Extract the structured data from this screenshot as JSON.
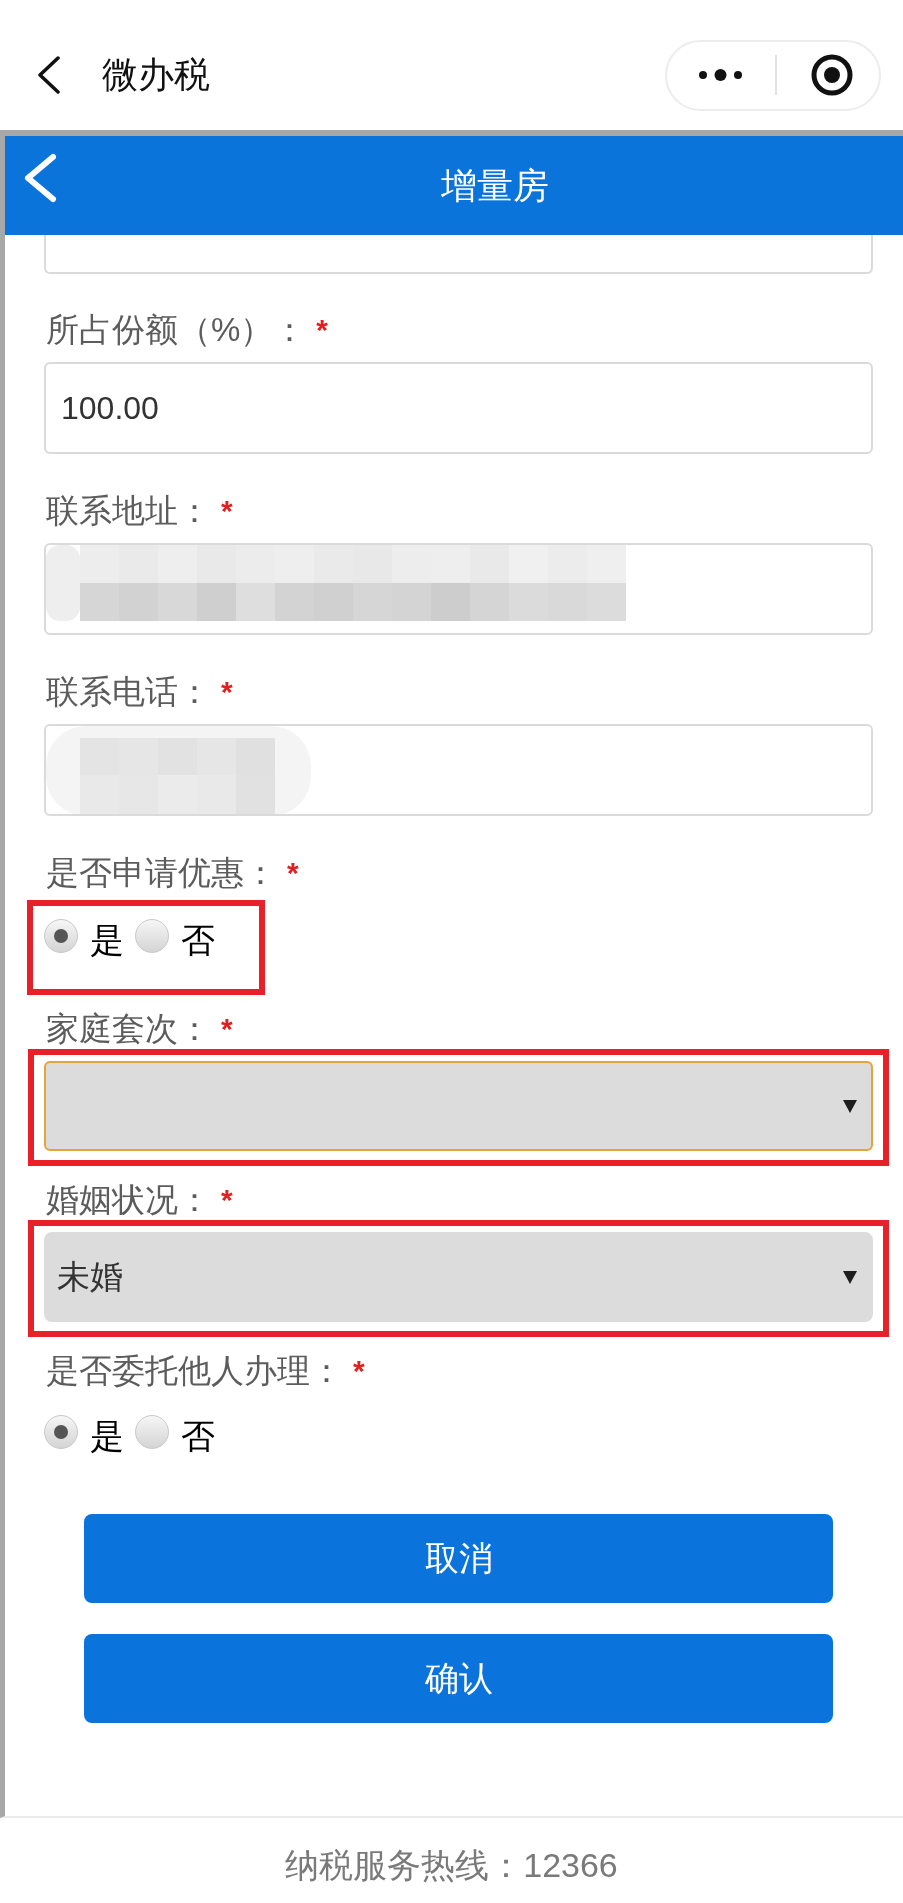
{
  "top_bar": {
    "title": "微办税"
  },
  "header": {
    "title": "增量房"
  },
  "form": {
    "fields": [
      {
        "kind": "input_edge"
      },
      {
        "kind": "input",
        "label": "所占份额（%）：",
        "required_mark": "*",
        "value": "100.00"
      },
      {
        "kind": "input",
        "label": "联系地址：",
        "required_mark": "*",
        "redacted": true
      },
      {
        "kind": "input",
        "label": "联系电话：",
        "required_mark": "*",
        "redacted": true
      },
      {
        "kind": "radio",
        "label": "是否申请优惠：",
        "required_mark": "*",
        "highlighted": true,
        "options": [
          {
            "label": "是",
            "selected": true
          },
          {
            "label": "否",
            "selected": false
          }
        ]
      },
      {
        "kind": "select",
        "label": "家庭套次：",
        "required_mark": "*",
        "highlighted": true,
        "focused": true
      },
      {
        "kind": "select",
        "label": "婚姻状况：",
        "required_mark": "*",
        "highlighted": true,
        "focused": false,
        "value": "未婚"
      },
      {
        "kind": "radio",
        "label": "是否委托他人办理：",
        "required_mark": "*",
        "options": [
          {
            "label": "是",
            "selected": true
          },
          {
            "label": "否",
            "selected": false
          }
        ]
      }
    ]
  },
  "buttons": [
    {
      "label": "取消"
    },
    {
      "label": "确认"
    }
  ],
  "footer": {
    "hotline": "纳税服务热线：12366"
  }
}
